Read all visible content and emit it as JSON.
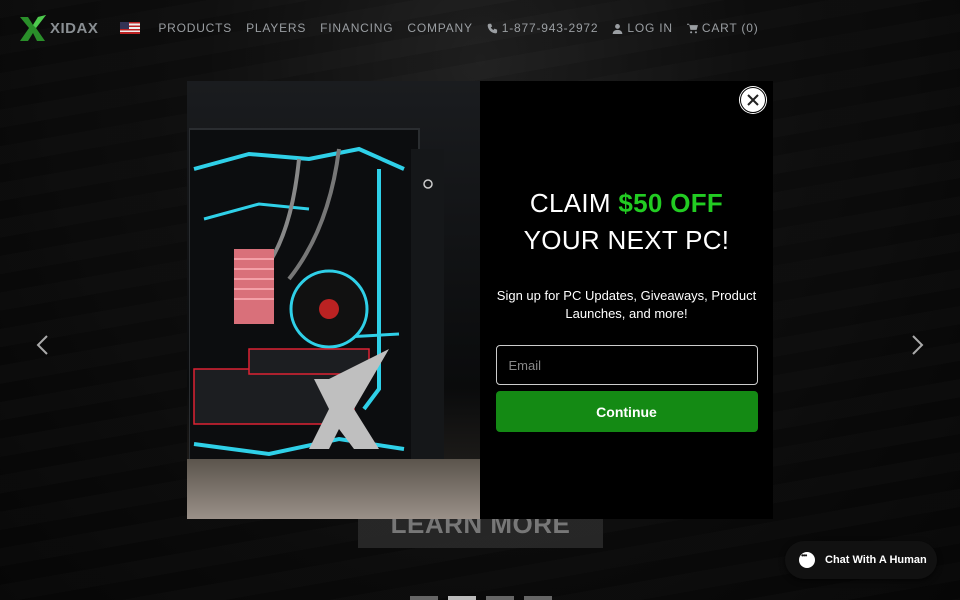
{
  "header": {
    "logo_text": "XIDAX",
    "nav": [
      {
        "label": "PRODUCTS"
      },
      {
        "label": "PLAYERS"
      },
      {
        "label": "FINANCING"
      },
      {
        "label": "COMPANY"
      }
    ],
    "phone": "1-877-943-2972",
    "login": "LOG IN",
    "cart": "CART (0)"
  },
  "hero": {
    "learn_more": "LEARN MORE",
    "slide_count": 4,
    "active_slide": 2
  },
  "modal": {
    "headline_pre": "CLAIM ",
    "headline_highlight": "$50 OFF",
    "headline_line2": "YOUR NEXT PC!",
    "subtext": "Sign up for PC Updates, Giveaways, Product Launches, and more!",
    "email_placeholder": "Email",
    "email_value": "",
    "continue_label": "Continue",
    "highlight_color": "#22cc22",
    "button_color": "#148a14"
  },
  "chat": {
    "label": "Chat With A Human"
  },
  "icons": {
    "close": "close-icon",
    "phone": "phone-icon",
    "user": "user-icon",
    "cart": "cart-icon",
    "prev": "chevron-left-icon",
    "next": "chevron-right-icon",
    "chat": "chat-bubble-icon"
  }
}
